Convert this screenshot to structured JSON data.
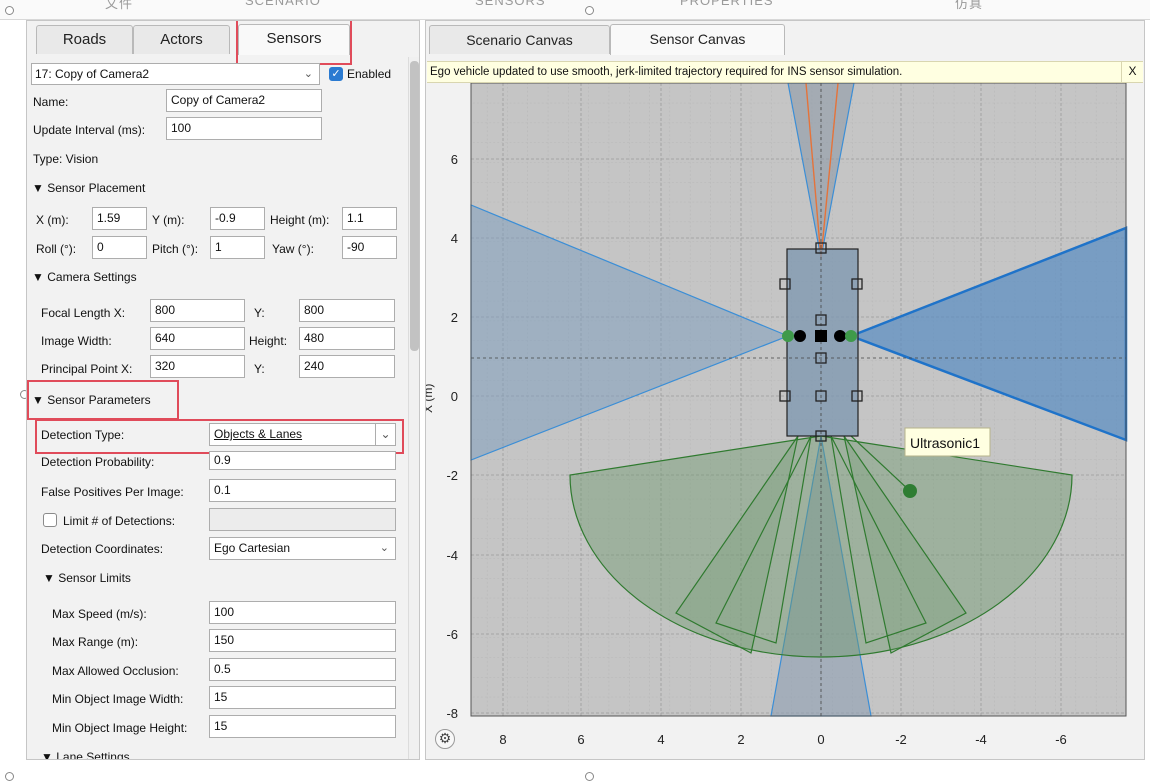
{
  "top_strip": {
    "labels": [
      "文件",
      "SCENARIO",
      "SENSORS",
      "PROPERTIES",
      "仿真"
    ]
  },
  "left_tabs": [
    {
      "label": "Roads"
    },
    {
      "label": "Actors"
    },
    {
      "label": "Sensors",
      "active": true
    }
  ],
  "sensor_select": {
    "value": "17: Copy of Camera2",
    "enabled_label": "Enabled",
    "enabled": true
  },
  "name": {
    "label": "Name:",
    "value": "Copy of Camera2"
  },
  "update_interval": {
    "label": "Update Interval (ms):",
    "value": "100"
  },
  "type_label": "Type: Vision",
  "placement": {
    "header": "Sensor Placement",
    "x_label": "X (m):",
    "x": "1.59",
    "y_label": "Y (m):",
    "y": "-0.9",
    "height_label": "Height (m):",
    "height": "1.1",
    "roll_label": "Roll (°):",
    "roll": "0",
    "pitch_label": "Pitch (°):",
    "pitch": "1",
    "yaw_label": "Yaw (°):",
    "yaw": "-90"
  },
  "camera": {
    "header": "Camera Settings",
    "focal_x_label": "Focal Length X:",
    "focal_x": "800",
    "focal_y_label": "Y:",
    "focal_y": "800",
    "width_label": "Image Width:",
    "width": "640",
    "height_label": "Height:",
    "height": "480",
    "pp_x_label": "Principal Point X:",
    "pp_x": "320",
    "pp_y_label": "Y:",
    "pp_y": "240"
  },
  "params": {
    "header": "Sensor Parameters",
    "detection_type_label": "Detection Type:",
    "detection_type": "Objects & Lanes",
    "detection_prob_label": "Detection Probability:",
    "detection_prob": "0.9",
    "false_pos_label": "False Positives Per Image:",
    "false_pos": "0.1",
    "limit_label": "Limit # of Detections:",
    "coords_label": "Detection Coordinates:",
    "coords": "Ego Cartesian"
  },
  "limits": {
    "header": "Sensor Limits",
    "max_speed_label": "Max Speed (m/s):",
    "max_speed": "100",
    "max_range_label": "Max Range (m):",
    "max_range": "150",
    "occlusion_label": "Max Allowed Occlusion:",
    "occlusion": "0.5",
    "min_w_label": "Min Object Image Width:",
    "min_w": "15",
    "min_h_label": "Min Object Image Height:",
    "min_h": "15"
  },
  "lane_header": "Lane Settings",
  "canvas_tabs": [
    {
      "label": "Scenario Canvas"
    },
    {
      "label": "Sensor Canvas",
      "active": true
    }
  ],
  "notice": {
    "text": "Ego vehicle updated to use smooth, jerk-limited trajectory required for INS sensor simulation.",
    "close": "X"
  },
  "canvas": {
    "x_ticks": [
      "8",
      "6",
      "4",
      "2",
      "0",
      "-2",
      "-4",
      "-6"
    ],
    "y_ticks": [
      "6",
      "4",
      "2",
      "0",
      "-2",
      "-4",
      "-6",
      "-8"
    ],
    "ylabel": "X (m)",
    "sensor_label": "Ultrasonic1",
    "colors": {
      "camera": "#3b8ed6",
      "radar": "#e5733a",
      "ultrasonic": "#2f7a2f",
      "grid_bg": "#c5c5c5"
    }
  }
}
